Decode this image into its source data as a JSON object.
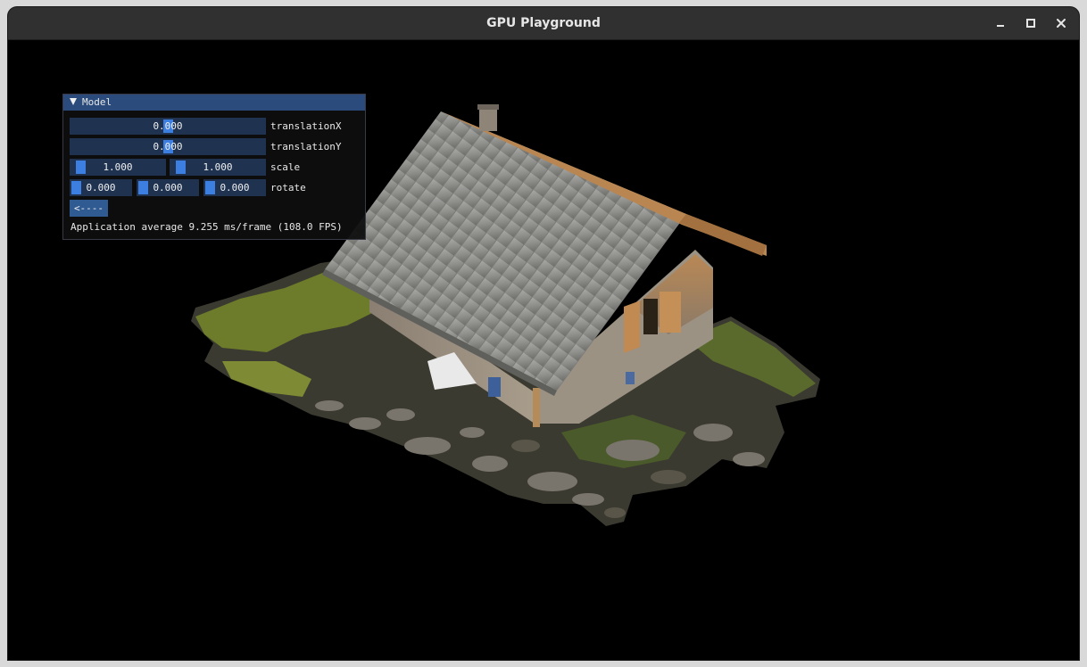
{
  "window": {
    "title": "GPU Playground",
    "controls": [
      "minimize-icon",
      "maximize-icon",
      "close-icon"
    ]
  },
  "panel": {
    "header": "Model",
    "collapsed": false,
    "rows": {
      "translationX": {
        "value": "0.000",
        "label": "translationX"
      },
      "translationY": {
        "value": "0.000",
        "label": "translationY"
      },
      "scale": {
        "values": [
          "1.000",
          "1.000"
        ],
        "label": "scale"
      },
      "rotate": {
        "values": [
          "0.000",
          "0.000",
          "0.000"
        ],
        "label": "rotate"
      }
    },
    "back_button": "<----",
    "stats": "Application average 9.255 ms/frame (108.0 FPS)"
  },
  "scene": {
    "subject": "3D model of a stone hut with metal roof on rocky grassy terrain",
    "background": "#000000"
  }
}
